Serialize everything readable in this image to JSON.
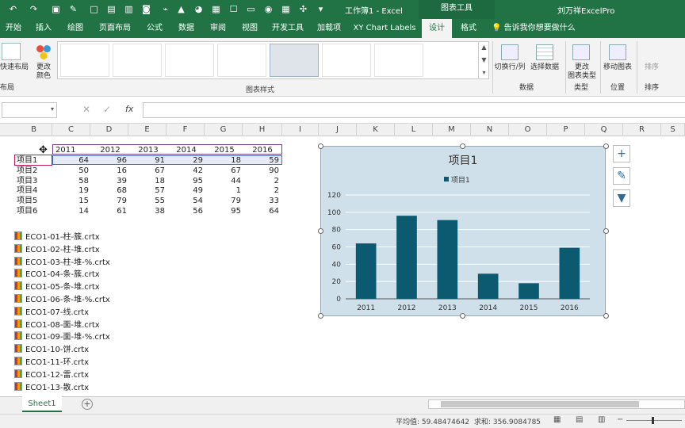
{
  "titlebar": {
    "title": "工作簿1 - Excel",
    "context_tab": "图表工具",
    "user": "刘万祥ExcelPro"
  },
  "tabs": [
    "开始",
    "插入",
    "绘图",
    "页面布局",
    "公式",
    "数据",
    "审阅",
    "视图",
    "开发工具",
    "加载项",
    "XY Chart Labels",
    "设计",
    "格式"
  ],
  "tell_me": "告诉我你想要做什么",
  "ribbon": {
    "quick_layout": "快速布局",
    "change_colors": "更改\n颜色",
    "gallery_label": "图表样式",
    "switch_row_col": "切换行/列",
    "select_data": "选择数据",
    "data_group": "数据",
    "change_type": "更改\n图表类型",
    "type_group": "类型",
    "move_chart": "移动图表",
    "location_group": "位置",
    "sort": "排序",
    "sort_group": "排序",
    "layout_group": "布局"
  },
  "formula_bar": {
    "fx": "fx"
  },
  "columns": [
    "B",
    "C",
    "D",
    "E",
    "F",
    "G",
    "H",
    "I",
    "J",
    "K",
    "L",
    "M",
    "N",
    "O",
    "P",
    "Q",
    "R",
    "S"
  ],
  "table": {
    "years": [
      "2011",
      "2012",
      "2013",
      "2014",
      "2015",
      "2016"
    ],
    "rows": [
      {
        "label": "项目1",
        "values": [
          "64",
          "96",
          "91",
          "29",
          "18",
          "59"
        ]
      },
      {
        "label": "项目2",
        "values": [
          "50",
          "16",
          "67",
          "42",
          "67",
          "90"
        ]
      },
      {
        "label": "项目3",
        "values": [
          "58",
          "39",
          "18",
          "95",
          "44",
          "2"
        ]
      },
      {
        "label": "项目4",
        "values": [
          "19",
          "68",
          "57",
          "49",
          "1",
          "2"
        ]
      },
      {
        "label": "项目5",
        "values": [
          "15",
          "79",
          "55",
          "54",
          "79",
          "33"
        ]
      },
      {
        "label": "项目6",
        "values": [
          "14",
          "61",
          "38",
          "56",
          "95",
          "64"
        ]
      }
    ]
  },
  "files": [
    "ECO1-01-柱-簇.crtx",
    "ECO1-02-柱-堆.crtx",
    "ECO1-03-柱-堆-%.crtx",
    "ECO1-04-条-簇.crtx",
    "ECO1-05-条-堆.crtx",
    "ECO1-06-条-堆-%.crtx",
    "ECO1-07-线.crtx",
    "ECO1-08-面-堆.crtx",
    "ECO1-09-面-堆-%.crtx",
    "ECO1-10-饼.crtx",
    "ECO1-11-环.crtx",
    "ECO1-12-雷.crtx",
    "ECO1-13-散.crtx"
  ],
  "chart_data": {
    "type": "bar",
    "title": "项目1",
    "categories": [
      "2011",
      "2012",
      "2013",
      "2014",
      "2015",
      "2016"
    ],
    "series": [
      {
        "name": "项目1",
        "values": [
          64,
          96,
          91,
          29,
          18,
          59
        ]
      }
    ],
    "ylim": [
      0,
      120
    ],
    "yticks": [
      "0",
      "20",
      "40",
      "60",
      "80",
      "100",
      "120"
    ],
    "legend": "top",
    "grid": true,
    "bar_color": "#0b5a70"
  },
  "sheet": {
    "tab": "Sheet1",
    "add": "+"
  },
  "status": {
    "average": "平均值: 59.48474642",
    "sum": "求和: 356.9084785"
  },
  "colors": {
    "excel_green": "#217346",
    "chart_bg": "#cfe0ea",
    "selection_purple": "#7b3f8f"
  }
}
